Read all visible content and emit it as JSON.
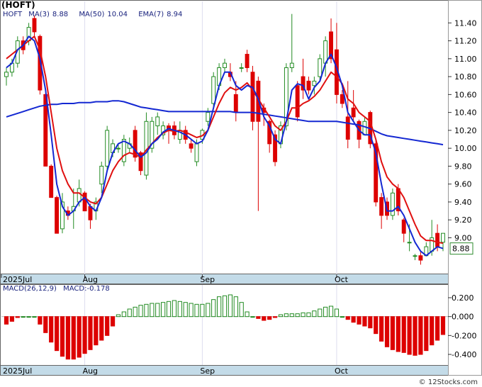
{
  "symbol_title": "(HOFT)",
  "legend": {
    "symbol": "HOFT",
    "ma3_label": "MA(3)",
    "ma3_value": "8.88",
    "ma50_label": "MA(50)",
    "ma50_value": "10.04",
    "ema7_label": "EMA(7)",
    "ema7_value": "8.94"
  },
  "price_badge": "8.88",
  "macd_legend": {
    "label": "MACD(26,12,9)",
    "value_label": "MACD:-0.178"
  },
  "footer": "© 12Stocks.com",
  "colors": {
    "up": "#228b22",
    "down": "#dd0000",
    "ma3": "#1428d2",
    "ma50": "#1428d2",
    "ema7": "#e01010",
    "axis_band": "#c3dbe8"
  },
  "chart_data": [
    {
      "type": "candlestick",
      "ylim": [
        8.6,
        11.64
      ],
      "y_ticks": [
        "11.40",
        "11.20",
        "11.00",
        "10.80",
        "10.60",
        "10.40",
        "10.20",
        "10.00",
        "9.80",
        "9.60",
        "9.40",
        "9.20",
        "9.00"
      ],
      "x_labels": [
        {
          "label": "2025Jul",
          "index": 0
        },
        {
          "label": "Aug",
          "index": 14
        },
        {
          "label": "Sep",
          "index": 35
        },
        {
          "label": "Oct",
          "index": 59
        }
      ],
      "candles": [
        [
          10.8,
          10.9,
          10.7,
          10.85
        ],
        [
          10.85,
          11.0,
          10.8,
          10.95
        ],
        [
          10.95,
          11.25,
          10.9,
          11.2
        ],
        [
          11.2,
          11.25,
          11.05,
          11.1
        ],
        [
          11.2,
          11.4,
          11.15,
          11.35
        ],
        [
          11.45,
          11.48,
          11.25,
          11.3
        ],
        [
          11.25,
          11.27,
          10.6,
          10.65
        ],
        [
          10.6,
          10.62,
          9.8,
          9.8
        ],
        [
          9.8,
          9.82,
          9.45,
          9.45
        ],
        [
          9.45,
          9.47,
          9.05,
          9.05
        ],
        [
          9.1,
          9.5,
          9.05,
          9.4
        ],
        [
          9.3,
          9.35,
          9.2,
          9.25
        ],
        [
          9.3,
          9.55,
          9.1,
          9.35
        ],
        [
          9.4,
          9.65,
          9.35,
          9.55
        ],
        [
          9.5,
          9.52,
          9.3,
          9.3
        ],
        [
          9.35,
          9.38,
          9.1,
          9.2
        ],
        [
          9.3,
          9.45,
          9.2,
          9.4
        ],
        [
          9.6,
          9.85,
          9.5,
          9.8
        ],
        [
          9.8,
          10.25,
          9.75,
          10.2
        ],
        [
          9.95,
          10.1,
          9.9,
          10.05
        ],
        [
          10.0,
          10.05,
          9.95,
          10.0
        ],
        [
          9.85,
          10.15,
          9.8,
          10.1
        ],
        [
          10.0,
          10.12,
          9.95,
          10.05
        ],
        [
          10.2,
          10.25,
          9.85,
          9.9
        ],
        [
          9.95,
          9.97,
          9.7,
          9.75
        ],
        [
          9.7,
          10.4,
          9.65,
          10.3
        ],
        [
          10.0,
          10.35,
          9.95,
          10.3
        ],
        [
          10.25,
          10.4,
          10.15,
          10.35
        ],
        [
          10.15,
          10.3,
          10.1,
          10.25
        ],
        [
          10.25,
          10.28,
          10.05,
          10.2
        ],
        [
          10.25,
          10.3,
          10.1,
          10.15
        ],
        [
          10.1,
          10.3,
          10.05,
          10.2
        ],
        [
          10.2,
          10.25,
          10.05,
          10.1
        ],
        [
          10.05,
          10.1,
          9.95,
          10.0
        ],
        [
          9.85,
          10.1,
          9.8,
          10.05
        ],
        [
          10.1,
          10.22,
          10.05,
          10.2
        ],
        [
          10.3,
          10.45,
          10.25,
          10.4
        ],
        [
          10.5,
          10.85,
          10.45,
          10.8
        ],
        [
          10.7,
          10.95,
          10.65,
          10.9
        ],
        [
          10.9,
          11.0,
          10.85,
          10.95
        ],
        [
          10.85,
          10.95,
          10.75,
          10.8
        ],
        [
          10.6,
          10.75,
          10.3,
          10.4
        ],
        [
          10.9,
          10.95,
          10.85,
          10.9
        ],
        [
          11.05,
          11.1,
          10.85,
          10.9
        ],
        [
          10.85,
          10.92,
          10.2,
          10.3
        ],
        [
          10.75,
          10.8,
          9.3,
          10.3
        ],
        [
          10.45,
          10.5,
          10.25,
          10.4
        ],
        [
          10.3,
          10.32,
          9.95,
          10.05
        ],
        [
          10.15,
          10.2,
          9.8,
          9.85
        ],
        [
          10.05,
          10.3,
          10.0,
          10.25
        ],
        [
          10.25,
          10.95,
          10.2,
          10.9
        ],
        [
          10.9,
          11.5,
          10.85,
          10.95
        ],
        [
          10.7,
          10.75,
          10.3,
          10.35
        ],
        [
          10.8,
          11.0,
          10.55,
          10.65
        ],
        [
          10.75,
          10.8,
          10.6,
          10.65
        ],
        [
          10.7,
          10.8,
          10.6,
          10.75
        ],
        [
          10.8,
          11.05,
          10.75,
          11.0
        ],
        [
          10.95,
          11.25,
          10.8,
          11.2
        ],
        [
          11.3,
          11.45,
          10.95,
          11.0
        ],
        [
          11.1,
          11.4,
          10.5,
          10.6
        ],
        [
          10.6,
          10.65,
          10.45,
          10.5
        ],
        [
          10.35,
          10.75,
          10.0,
          10.1
        ],
        [
          10.45,
          10.65,
          10.3,
          10.35
        ],
        [
          10.3,
          10.32,
          10.0,
          10.1
        ],
        [
          10.15,
          10.35,
          10.15,
          10.3
        ],
        [
          10.4,
          10.42,
          10.0,
          10.05
        ],
        [
          10.05,
          10.1,
          9.35,
          9.4
        ],
        [
          9.45,
          9.5,
          9.1,
          9.25
        ],
        [
          9.4,
          9.45,
          9.2,
          9.25
        ],
        [
          9.25,
          9.55,
          9.2,
          9.5
        ],
        [
          9.55,
          9.6,
          9.25,
          9.3
        ],
        [
          9.2,
          9.22,
          8.95,
          9.05
        ],
        [
          8.95,
          9.15,
          8.85,
          8.95
        ],
        [
          8.8,
          8.82,
          8.75,
          8.8
        ],
        [
          8.8,
          8.85,
          8.7,
          8.75
        ],
        [
          8.8,
          8.95,
          8.8,
          8.9
        ],
        [
          8.85,
          9.2,
          8.8,
          9.0
        ],
        [
          9.05,
          9.15,
          8.85,
          8.9
        ],
        [
          8.95,
          9.05,
          8.85,
          9.05
        ]
      ],
      "ma3_index_start": 0,
      "ma3": [
        10.9,
        10.95,
        11.1,
        11.15,
        11.25,
        11.2,
        11.0,
        10.65,
        10.15,
        9.6,
        9.35,
        9.25,
        9.3,
        9.4,
        9.45,
        9.35,
        9.3,
        9.45,
        9.75,
        9.95,
        10.05,
        10.08,
        10.05,
        9.98,
        9.9,
        9.95,
        10.05,
        10.1,
        10.18,
        10.22,
        10.2,
        10.18,
        10.15,
        10.1,
        10.05,
        10.08,
        10.2,
        10.45,
        10.7,
        10.85,
        10.85,
        10.7,
        10.65,
        10.7,
        10.68,
        10.55,
        10.35,
        10.25,
        10.1,
        10.05,
        10.3,
        10.65,
        10.72,
        10.7,
        10.55,
        10.68,
        10.75,
        10.95,
        11.05,
        10.9,
        10.7,
        10.4,
        10.3,
        10.2,
        10.15,
        10.15,
        9.95,
        9.6,
        9.3,
        9.3,
        9.35,
        9.25,
        9.1,
        8.95,
        8.85,
        8.8,
        8.85,
        8.9,
        8.88
      ],
      "ma50": [
        10.35,
        10.37,
        10.39,
        10.41,
        10.43,
        10.45,
        10.47,
        10.48,
        10.49,
        10.49,
        10.5,
        10.5,
        10.5,
        10.51,
        10.51,
        10.51,
        10.52,
        10.52,
        10.52,
        10.53,
        10.53,
        10.52,
        10.5,
        10.48,
        10.46,
        10.45,
        10.44,
        10.43,
        10.42,
        10.41,
        10.41,
        10.41,
        10.41,
        10.41,
        10.41,
        10.41,
        10.41,
        10.41,
        10.41,
        10.41,
        10.41,
        10.4,
        10.4,
        10.4,
        10.4,
        10.39,
        10.38,
        10.37,
        10.36,
        10.35,
        10.34,
        10.33,
        10.32,
        10.31,
        10.3,
        10.3,
        10.3,
        10.3,
        10.3,
        10.3,
        10.29,
        10.28,
        10.27,
        10.26,
        10.24,
        10.22,
        10.19,
        10.16,
        10.14,
        10.13,
        10.12,
        10.11,
        10.1,
        10.09,
        10.08,
        10.07,
        10.06,
        10.05,
        10.04
      ],
      "ma50_index_start": 0,
      "ema7": [
        11.0,
        11.05,
        11.1,
        11.15,
        11.2,
        11.25,
        11.1,
        10.8,
        10.4,
        10.0,
        9.75,
        9.6,
        9.5,
        9.5,
        9.45,
        9.4,
        9.38,
        9.45,
        9.6,
        9.75,
        9.85,
        9.92,
        9.95,
        9.93,
        9.9,
        9.98,
        10.05,
        10.12,
        10.17,
        10.2,
        10.19,
        10.2,
        10.18,
        10.15,
        10.12,
        10.14,
        10.2,
        10.35,
        10.5,
        10.62,
        10.68,
        10.65,
        10.68,
        10.73,
        10.65,
        10.55,
        10.45,
        10.35,
        10.25,
        10.2,
        10.3,
        10.45,
        10.45,
        10.5,
        10.53,
        10.58,
        10.65,
        10.75,
        10.85,
        10.8,
        10.72,
        10.55,
        10.5,
        10.4,
        10.35,
        10.3,
        10.1,
        9.85,
        9.68,
        9.6,
        9.55,
        9.45,
        9.3,
        9.15,
        9.02,
        8.97,
        8.97,
        8.95,
        8.94
      ],
      "ema7_index_start": 0
    },
    {
      "type": "bar",
      "title": "MACD(26,12,9)",
      "ylim": [
        -0.52,
        0.26
      ],
      "y_ticks": [
        "0.200",
        "0.000",
        "-0.200",
        "-0.400"
      ],
      "x_labels": [
        {
          "label": "2025Jul",
          "index": 0
        },
        {
          "label": "Aug",
          "index": 14
        },
        {
          "label": "Sep",
          "index": 35
        },
        {
          "label": "Oct",
          "index": 59
        }
      ],
      "values": [
        -0.08,
        -0.05,
        -0.01,
        0.0,
        0.0,
        0.0,
        -0.08,
        -0.17,
        -0.27,
        -0.36,
        -0.42,
        -0.45,
        -0.45,
        -0.43,
        -0.39,
        -0.35,
        -0.3,
        -0.25,
        -0.2,
        -0.1,
        0.02,
        0.05,
        0.08,
        0.1,
        0.12,
        0.13,
        0.14,
        0.14,
        0.15,
        0.16,
        0.17,
        0.16,
        0.15,
        0.14,
        0.13,
        0.13,
        0.14,
        0.18,
        0.21,
        0.22,
        0.23,
        0.21,
        0.15,
        0.05,
        0.0,
        -0.02,
        -0.04,
        -0.03,
        -0.01,
        0.02,
        0.03,
        0.03,
        0.03,
        0.04,
        0.04,
        0.06,
        0.08,
        0.1,
        0.11,
        0.08,
        0.0,
        -0.03,
        -0.06,
        -0.08,
        -0.1,
        -0.12,
        -0.18,
        -0.26,
        -0.32,
        -0.35,
        -0.37,
        -0.38,
        -0.4,
        -0.41,
        -0.4,
        -0.36,
        -0.3,
        -0.25,
        -0.19
      ],
      "series": [
        {
          "name": "MACD:-0.178"
        }
      ]
    }
  ]
}
